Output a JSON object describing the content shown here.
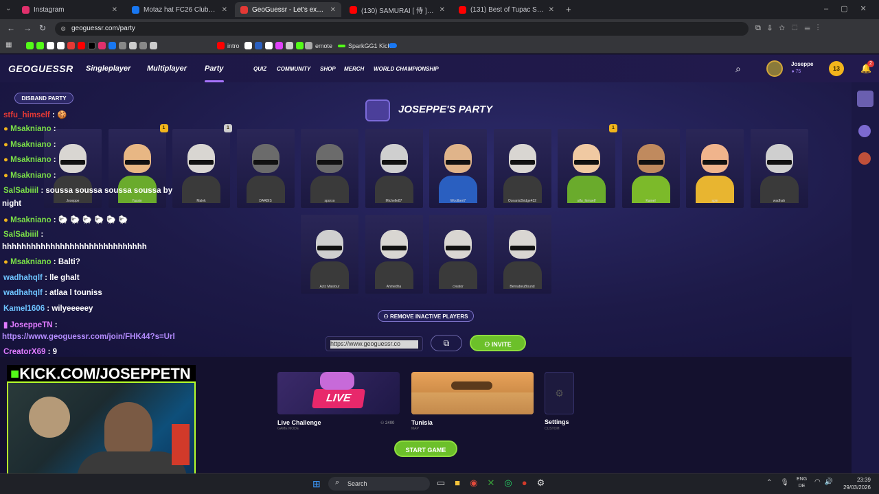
{
  "browser": {
    "tabs": [
      {
        "title": "Instagram",
        "color": "#e1306c"
      },
      {
        "title": "Motaz hat FC26 Clubs 🔮 eine",
        "color": "#1877f2"
      },
      {
        "title": "GeoGuessr - Let's explore the w",
        "color": "#e53935"
      },
      {
        "title": "(130) SAMURAI [ 侍 ] Japan",
        "color": "#ff0000"
      },
      {
        "title": "(131) Best of Tupac Shakur",
        "color": "#ff0000"
      }
    ],
    "url": "geoguessr.com/party",
    "bookmarks": [
      "intro",
      "emote",
      "SparkGG1 Kick"
    ]
  },
  "gg": {
    "logo": "GEOGUESSR",
    "nav": [
      "Singleplayer",
      "Multiplayer",
      "Party"
    ],
    "nav_small": [
      "QUIZ",
      "COMMUNITY",
      "SHOP",
      "MERCH",
      "WORLD CHAMPIONSHIP"
    ],
    "user": {
      "name": "Joseppe",
      "coins": "75",
      "level": "13",
      "notifications": "2"
    }
  },
  "party": {
    "disband": "DISBAND PARTY",
    "title": "JOSEPPE'S PARTY",
    "row1": [
      {
        "name": "Joseppe",
        "shirt": "#3a3a3a",
        "skin": "#d9d6d2"
      },
      {
        "name": "Yassin",
        "shirt": "#6aab2c",
        "skin": "#e8b784",
        "badge": "1"
      },
      {
        "name": "Malek",
        "shirt": "#3a3a3a",
        "skin": "#d9d6d2",
        "badge": "1"
      },
      {
        "name": "DAABIS",
        "shirt": "#3a3a3a",
        "skin": "#6b6b6b"
      },
      {
        "name": "sporxo",
        "shirt": "#3a3a3a",
        "skin": "#6b6b6b"
      },
      {
        "name": "Michelle87",
        "shirt": "#3a3a3a",
        "skin": "#cfcfcf"
      },
      {
        "name": "Woolberi7",
        "shirt": "#2a5fc0",
        "skin": "#e0b48a"
      },
      {
        "name": "OceanicBridge432",
        "shirt": "#3a3a3a",
        "skin": "#d9d6d2"
      },
      {
        "name": "stfu_himself",
        "shirt": "#6aab2c",
        "skin": "#f0c9a2",
        "badge": "1"
      },
      {
        "name": "Kamel",
        "shirt": "#7cba2a",
        "skin": "#c08a5e"
      },
      {
        "name": "spin",
        "shirt": "#e8b530",
        "skin": "#f0b48c"
      },
      {
        "name": "wadhah",
        "shirt": "#3a3a3a",
        "skin": "#cfcfcf"
      }
    ],
    "row2": [
      {
        "name": "Aziz Mastour",
        "shirt": "#3a3a3a",
        "skin": "#cfcfcf"
      },
      {
        "name": "Ahmedha",
        "shirt": "#3a3a3a",
        "skin": "#d9d6d2"
      },
      {
        "name": "creator",
        "shirt": "#3a3a3a",
        "skin": "#d9d6d2"
      },
      {
        "name": "BernabeuBound",
        "shirt": "#3a3a3a",
        "skin": "#d9d6d2"
      }
    ],
    "remove_inactive": "REMOVE INACTIVE PLAYERS",
    "invite_link": "https://www.geoguessr.co",
    "invite": "INVITE",
    "mode": {
      "title": "Live Challenge",
      "sub": "GAME MODE",
      "players": "2400",
      "live": "LIVE"
    },
    "map": {
      "title": "Tunisia",
      "sub": "MAP"
    },
    "settings": {
      "title": "Settings",
      "sub": "CUSTOM"
    },
    "start": "START GAME"
  },
  "chat": [
    {
      "user": "stfu_himself",
      "text": " : 🍪",
      "color": "#e53935"
    },
    {
      "user": "Msakniano",
      "text": " : ",
      "color": "#7be047"
    },
    {
      "user": "Msakniano",
      "text": " : ",
      "color": "#7be047"
    },
    {
      "user": "Msakniano",
      "text": " : ",
      "color": "#7be047"
    },
    {
      "user": "Msakniano",
      "text": " : ",
      "color": "#7be047"
    },
    {
      "user": "SalSabiiil",
      "text": " : soussa soussa soussa soussa by",
      "color": "#7be047"
    },
    {
      "user": "",
      "text": "night",
      "color": "#fff"
    },
    {
      "user": "Msakniano",
      "text": " : 🐑 🐑 🐑 🐑 🐑 🐑",
      "color": "#7be047"
    },
    {
      "user": "SalSabiiil",
      "text": " :",
      "color": "#7be047"
    },
    {
      "user": "",
      "text": "hhhhhhhhhhhhhhhhhhhhhhhhhhhhhh",
      "color": "#fff"
    },
    {
      "user": "Msakniano",
      "text": " : Balti?",
      "color": "#7be047"
    },
    {
      "user": "wadhahqlf",
      "text": " : lle ghalt",
      "color": "#6ec3ff"
    },
    {
      "user": "wadhahqlf",
      "text": " : atlaa l touniss",
      "color": "#6ec3ff"
    },
    {
      "user": "Kamel1606",
      "text": " : wilyeeeeey",
      "color": "#6ec3ff"
    },
    {
      "user": "JoseppeTN",
      "text": " :",
      "color": "#e07bff"
    },
    {
      "user": "",
      "text": "https://www.geoguessr.com/join/FHK44?s=Url",
      "color": "#b48cff"
    },
    {
      "user": "CreatorX69",
      "text": " : 9",
      "color": "#e07bff"
    }
  ],
  "stream": {
    "banner": "KICK.COM/JOSEPPETN"
  },
  "taskbar": {
    "search": "Search",
    "lang1": "ENG",
    "lang2": "DE",
    "time": "23:39",
    "date": "29/03/2026"
  }
}
